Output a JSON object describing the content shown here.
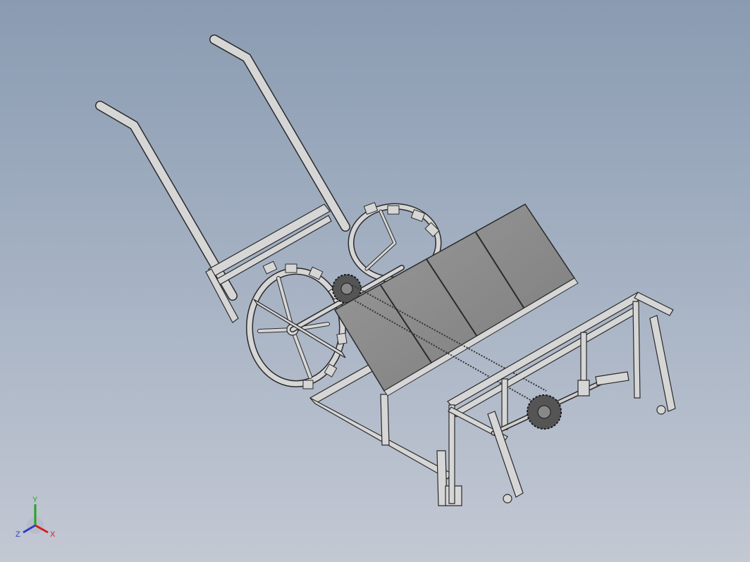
{
  "viewport": {
    "background_top": "#8a9bb1",
    "background_bottom": "#c3c8d3"
  },
  "model": {
    "part_color": "#d6d6d6",
    "edge_color": "#2a2a2a",
    "hopper_color": "#8d8d8d"
  },
  "triad": {
    "x_label": "X",
    "y_label": "Y",
    "z_label": "Z",
    "x_color": "#d11f1f",
    "y_color": "#1ea81e",
    "z_color": "#2a3fc9"
  }
}
